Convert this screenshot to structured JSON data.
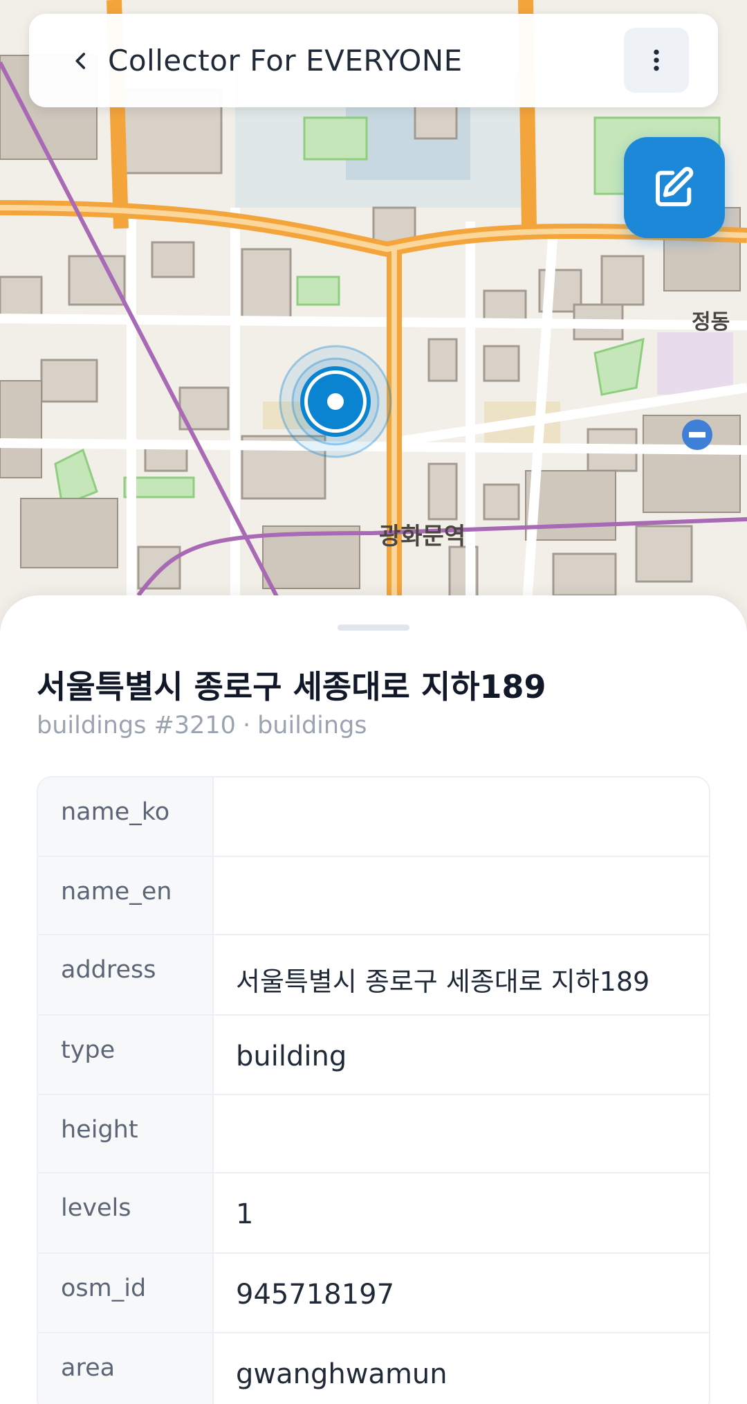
{
  "appbar": {
    "title": "Collector For EVERYONE",
    "back_icon": "chevron-left-icon",
    "more_icon": "more-vertical-icon"
  },
  "fab": {
    "icon": "edit-icon",
    "color": "#1e88d8"
  },
  "map": {
    "labels": {
      "station": "광화문역",
      "district": "정동"
    },
    "marker_color": "#0a84d0"
  },
  "sheet": {
    "title": "서울특별시 종로구 세종대로 지하189",
    "subtitle_layer": "buildings #3210",
    "subtitle_separator": "·",
    "subtitle_type": "buildings",
    "properties": [
      {
        "key": "name_ko",
        "value": ""
      },
      {
        "key": "name_en",
        "value": ""
      },
      {
        "key": "address",
        "value": "서울특별시 종로구 세종대로 지하189"
      },
      {
        "key": "type",
        "value": "building"
      },
      {
        "key": "height",
        "value": ""
      },
      {
        "key": "levels",
        "value": "1"
      },
      {
        "key": "osm_id",
        "value": "945718197"
      },
      {
        "key": "area",
        "value": "gwanghwamun"
      }
    ]
  }
}
